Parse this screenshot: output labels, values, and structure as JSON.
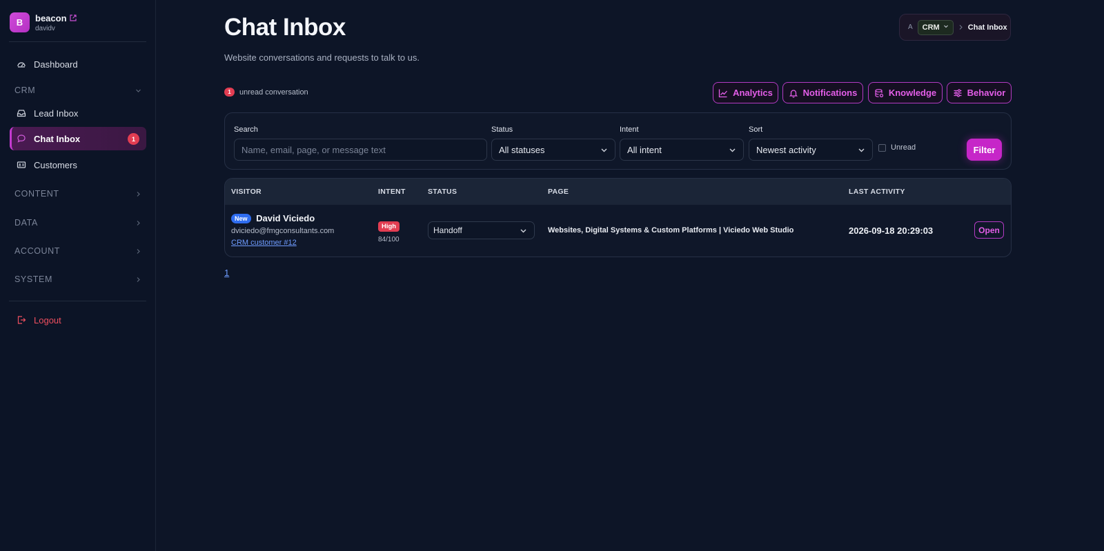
{
  "brand": {
    "initial": "B",
    "name": "beacon",
    "user": "davidv"
  },
  "sidebar": {
    "dashboard": "Dashboard",
    "crm_section": "CRM",
    "lead_inbox": "Lead Inbox",
    "chat_inbox": "Chat Inbox",
    "chat_inbox_badge": "1",
    "customers": "Customers",
    "content_section": "CONTENT",
    "data_section": "DATA",
    "account_section": "ACCOUNT",
    "system_section": "SYSTEM",
    "logout": "Logout"
  },
  "header": {
    "title": "Chat Inbox",
    "subtitle": "Website conversations and requests to talk to us."
  },
  "breadcrumb": {
    "home": "A",
    "crm": "CRM",
    "current": "Chat Inbox"
  },
  "unread": {
    "count": "1",
    "label": "unread conversation"
  },
  "toolbar": {
    "analytics": "Analytics",
    "notifications": "Notifications",
    "knowledge": "Knowledge",
    "behavior": "Behavior"
  },
  "filters": {
    "search_label": "Search",
    "search_placeholder": "Name, email, page, or message text",
    "status_label": "Status",
    "status_value": "All statuses",
    "intent_label": "Intent",
    "intent_value": "All intent",
    "sort_label": "Sort",
    "sort_value": "Newest activity",
    "unread_label": "Unread",
    "filter_button": "Filter"
  },
  "table": {
    "headers": [
      "VISITOR",
      "INTENT",
      "STATUS",
      "PAGE",
      "LAST ACTIVITY"
    ],
    "rows": [
      {
        "new_badge": "New",
        "name": "David Viciedo",
        "email": "dviciedo@fmgconsultants.com",
        "crm_link": "CRM customer #12",
        "intent_level": "High",
        "intent_score": "84/100",
        "status": "Handoff",
        "page": "Websites, Digital Systems & Custom Platforms | Viciedo Web Studio",
        "last_activity": "2026-09-18 20:29:03",
        "action": "Open"
      }
    ]
  },
  "pagination": {
    "current": "1"
  },
  "colors": {
    "accent": "#c626c8",
    "badge_red": "#e23d52",
    "link_blue": "#6f9cff",
    "background": "#0d1527"
  }
}
